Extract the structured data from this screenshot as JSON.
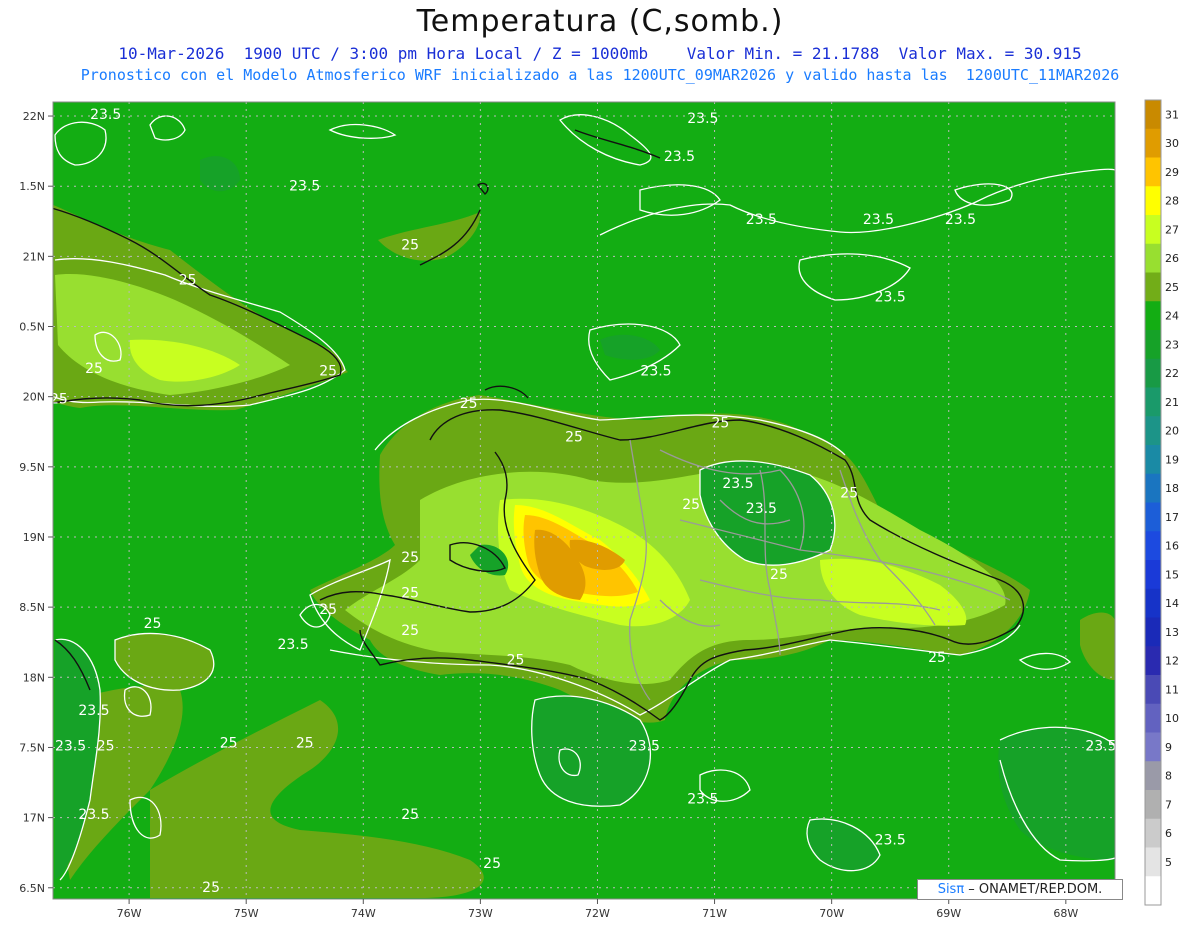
{
  "title": "Temperatura (C,somb.)",
  "subtitle_1": "10-Mar-2026  1900 UTC / 3:00 pm Hora Local / Z = 1000mb    Valor Min. = 21.1788  Valor Max. = 30.915",
  "subtitle_2": "Pronostico con el Modelo Atmosferico WRF inicializado a las 1200UTC_09MAR2026 y valido hasta las  1200UTC_11MAR2026",
  "credit": {
    "logo": "Sisπ",
    "text": " – ONAMET/REP.DOM."
  },
  "colors": {
    "background": "#ffffff",
    "ocean": "#13ad13",
    "land": "#6aa814",
    "contour": "#ffffff",
    "coast": "#111111",
    "borders": "#9a9a9a"
  },
  "lat_labels": [
    "22N",
    "1.5N",
    "21N",
    "0.5N",
    "20N",
    "9.5N",
    "19N",
    "8.5N",
    "18N",
    "7.5N",
    "17N",
    "6.5N"
  ],
  "lon_labels": [
    "76W",
    "75W",
    "74W",
    "73W",
    "72W",
    "71W",
    "70W",
    "69W",
    "68W"
  ],
  "colorbar": {
    "labels": [
      "31",
      "30",
      "29",
      "28",
      "27",
      "26",
      "25",
      "24",
      "23",
      "22",
      "21",
      "20",
      "19",
      "18",
      "17",
      "16",
      "15",
      "14",
      "13",
      "12",
      "11",
      "10",
      "9",
      "8",
      "7",
      "6",
      "5"
    ],
    "colors": [
      "#c98a00",
      "#e09c00",
      "#ffc400",
      "#ffff00",
      "#c8ff20",
      "#98df30",
      "#72ad18",
      "#13ad13",
      "#16a228",
      "#189a45",
      "#1a9a6a",
      "#1c9488",
      "#1a8aa5",
      "#1a75c0",
      "#1c5ed8",
      "#1c4ae0",
      "#1a3ad8",
      "#1633c8",
      "#1a2ab8",
      "#2a2ab0",
      "#4a4ab5",
      "#6262c0",
      "#7878c8",
      "#9a9aa8",
      "#b0b0b0",
      "#cbcbcb",
      "#e4e4e4",
      "#ffffff"
    ]
  },
  "contour_labels": [
    {
      "text": "23.5",
      "lon": -76.2,
      "lat": 21.98
    },
    {
      "text": "23.5",
      "lon": -74.5,
      "lat": 21.47
    },
    {
      "text": "23.5",
      "lon": -71.1,
      "lat": 21.95
    },
    {
      "text": "23.5",
      "lon": -71.3,
      "lat": 21.68
    },
    {
      "text": "23.5",
      "lon": -70.6,
      "lat": 21.23
    },
    {
      "text": "23.5",
      "lon": -69.6,
      "lat": 21.23
    },
    {
      "text": "23.5",
      "lon": -68.9,
      "lat": 21.23
    },
    {
      "text": "23.5",
      "lon": -69.5,
      "lat": 20.68
    },
    {
      "text": "23.5",
      "lon": -71.5,
      "lat": 20.15
    },
    {
      "text": "25",
      "lon": -73.6,
      "lat": 21.05
    },
    {
      "text": "25",
      "lon": -75.5,
      "lat": 20.8
    },
    {
      "text": "25",
      "lon": -76.3,
      "lat": 20.17
    },
    {
      "text": "25",
      "lon": -76.6,
      "lat": 19.95
    },
    {
      "text": "25",
      "lon": -74.3,
      "lat": 20.15
    },
    {
      "text": "25",
      "lon": -73.1,
      "lat": 19.92
    },
    {
      "text": "25",
      "lon": -72.2,
      "lat": 19.68
    },
    {
      "text": "25",
      "lon": -70.95,
      "lat": 19.78
    },
    {
      "text": "23.5",
      "lon": -70.8,
      "lat": 19.35
    },
    {
      "text": "25",
      "lon": -71.2,
      "lat": 19.2
    },
    {
      "text": "23.5",
      "lon": -70.6,
      "lat": 19.17
    },
    {
      "text": "25",
      "lon": -69.85,
      "lat": 19.28
    },
    {
      "text": "25",
      "lon": -73.6,
      "lat": 18.82
    },
    {
      "text": "25",
      "lon": -70.45,
      "lat": 18.7
    },
    {
      "text": "25",
      "lon": -73.6,
      "lat": 18.57
    },
    {
      "text": "25",
      "lon": -74.3,
      "lat": 18.45
    },
    {
      "text": "25",
      "lon": -73.6,
      "lat": 18.3
    },
    {
      "text": "23.5",
      "lon": -74.6,
      "lat": 18.2
    },
    {
      "text": "25",
      "lon": -72.7,
      "lat": 18.09
    },
    {
      "text": "25",
      "lon": -75.8,
      "lat": 18.35
    },
    {
      "text": "25",
      "lon": -69.1,
      "lat": 18.11
    },
    {
      "text": "23.5",
      "lon": -76.3,
      "lat": 17.73
    },
    {
      "text": "23.5",
      "lon": -76.5,
      "lat": 17.48
    },
    {
      "text": "25",
      "lon": -76.2,
      "lat": 17.48
    },
    {
      "text": "25",
      "lon": -75.15,
      "lat": 17.5
    },
    {
      "text": "25",
      "lon": -74.5,
      "lat": 17.5
    },
    {
      "text": "23.5",
      "lon": -71.6,
      "lat": 17.48
    },
    {
      "text": "23.5",
      "lon": -71.1,
      "lat": 17.1
    },
    {
      "text": "23.5",
      "lon": -67.7,
      "lat": 17.48
    },
    {
      "text": "23.5",
      "lon": -76.3,
      "lat": 16.99
    },
    {
      "text": "25",
      "lon": -73.6,
      "lat": 16.99
    },
    {
      "text": "23.5",
      "lon": -69.5,
      "lat": 16.81
    },
    {
      "text": "25",
      "lon": -72.9,
      "lat": 16.64
    },
    {
      "text": "25",
      "lon": -75.3,
      "lat": 16.47
    }
  ]
}
